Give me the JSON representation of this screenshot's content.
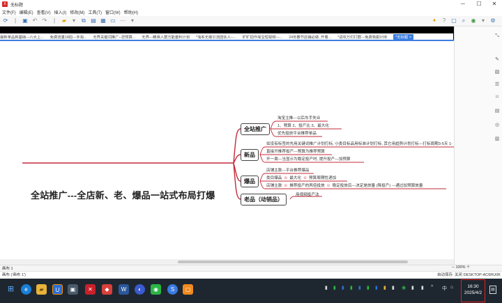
{
  "window": {
    "title": "无标题",
    "app_badge": "X"
  },
  "menu": [
    "文件(F)",
    "编辑(E)",
    "查看(V)",
    "插入(I)",
    "修改(M)",
    "工具(T)",
    "窗口(W)",
    "帮助(H)"
  ],
  "tabs": [
    "最新单品新基础---六大上...",
    "免费流量18招---手淘...",
    "无界关键词推广--您预算...",
    "无界---精准人群万能套利计划",
    "*淘系无痕引流团伙人--...",
    "旷旷招作淘宝短视频---...",
    "24年春节店铺必做, 开着...",
    "*进攻万们打群---免费我勤计持"
  ],
  "active_tab": "*无标题",
  "mindmap": {
    "root": "全站推广---全店新、老、爆品一站式布局打爆",
    "topics": [
      {
        "label": "全站推广",
        "leaves": [
          "淘宝主推---以后车手失业",
          "1、预算   2、投产比   3、最大化",
          "优先投放平台推荐单品"
        ]
      },
      {
        "label": "新品",
        "leaves": [
          "如没有标签的先用关键词推广计划打标, 小类目标品用标准计划打标, 其它用趋势计划打标---打标周期3-5天  1-",
          "直接开推荐投产---预算为推荐预算",
          "开一周---当显示为稳定投产时, 提升投产---加预算"
        ]
      },
      {
        "label": "爆品",
        "leaves": [
          "店铺主款---平台推荐爆品",
          "类目爆品",
          "最大化",
          "预算周期性递加",
          "店铺主款",
          "推荐投产的两倍投放",
          "稳定投放后---决定是放量 (降投产) ---通过加预算放量"
        ]
      },
      {
        "label": "老品（动销品）",
        "leaves": [
          "用视频投产法"
        ]
      }
    ]
  },
  "sheet": "画布 1",
  "zoom": "100%",
  "status": {
    "left": "画布 ('画布 1')",
    "autosave": "自动保存: 关闭",
    "computer": "DESKTOP-AC6RU0K"
  },
  "clock": {
    "time": "16:30",
    "date": "2025/4/2"
  },
  "tray": {
    "ime": "中"
  },
  "colors": {
    "accent": "#3b7de0",
    "branch": "#c4283a",
    "root_line": "#c4283a"
  }
}
